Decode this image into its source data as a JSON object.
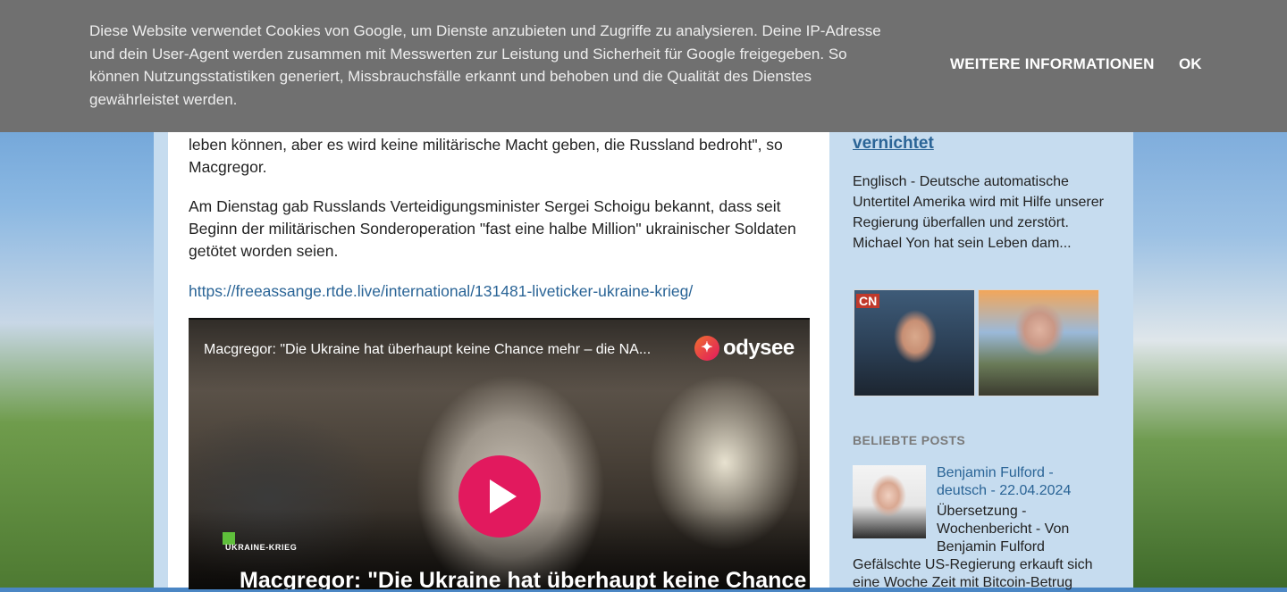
{
  "cookie_bar": {
    "text": "Diese Website verwendet Cookies von Google, um Dienste anzubieten und Zugriffe zu analysieren. Deine IP-Adresse und dein User-Agent werden zusammen mit Messwerten zur Leistung und Sicherheit für Google freigegeben. So können Nutzungsstatistiken generiert, Missbrauchsfälle erkannt und behoben und die Qualität des Dienstes gewährleistet werden.",
    "more_label": "WEITERE INFORMATIONEN",
    "ok_label": "OK"
  },
  "post": {
    "paragraph_1": "leben können, aber es wird keine militärische Macht geben, die Russland bedroht\", so Macgregor.",
    "paragraph_2": "Am Dienstag gab Russlands Verteidigungsminister Sergei Schoigu bekannt, dass seit Beginn der militärischen Sonderoperation \"fast eine halbe Million\" ukrainischer Soldaten getötet worden seien.",
    "link": "https://freeassange.rtde.live/international/131481-liveticker-ukraine-krieg/"
  },
  "video": {
    "title": "Macgregor: \"Die Ukraine hat überhaupt keine Chance mehr – die NA...",
    "platform": "odysee",
    "tag": "UKRAINE-KRIEG",
    "headline": "Macgregor: \"Die Ukraine hat überhaupt keine Chance"
  },
  "sidebar": {
    "post_title": "vernichtet",
    "post_snippet": "Englisch - Deutsche automatische Untertitel Amerika wird mit Hilfe unserer Regierung überfallen und zerstört. Michael Yon hat sein Leben dam...",
    "thumb_logo": "CN",
    "popular_heading": "BELIEBTE POSTS",
    "popular": {
      "title": "Benjamin Fulford - deutsch - 22.04.2024",
      "subtitle": "Übersetzung - Wochenbericht - Von Benjamin Fulford",
      "snippet": "Gefälschte US-Regierung erkauft sich eine Woche Zeit mit Bitcoin-Betrug"
    }
  }
}
